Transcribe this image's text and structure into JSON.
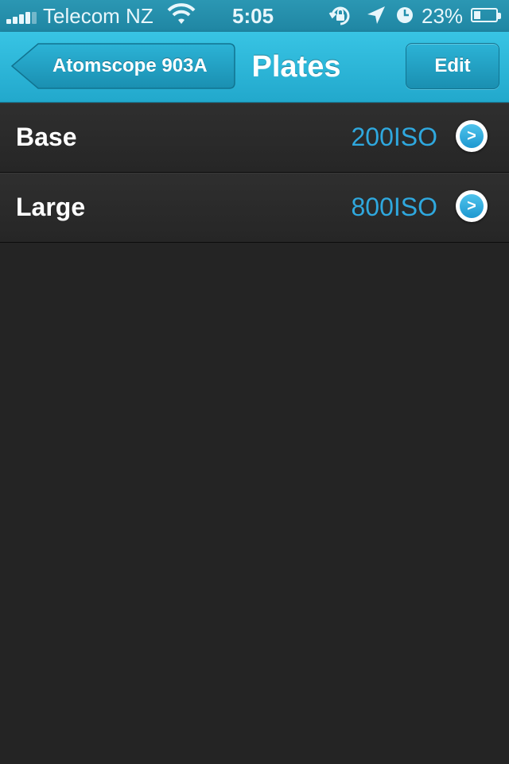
{
  "status_bar": {
    "carrier": "Telecom NZ",
    "time": "5:05",
    "battery": "23%",
    "battery_level": 0.23,
    "icons": [
      "signal-icon",
      "wifi-icon",
      "orientation-lock-icon",
      "location-icon",
      "alarm-icon",
      "battery-charging-icon"
    ]
  },
  "nav": {
    "back_label": "Atomscope 903A",
    "title": "Plates",
    "edit_label": "Edit"
  },
  "plates": [
    {
      "name": "Base",
      "value": "200ISO"
    },
    {
      "name": "Large",
      "value": "800ISO"
    }
  ],
  "colors": {
    "accent": "#2aafd3",
    "value_text": "#2fa8de",
    "background": "#242424"
  }
}
